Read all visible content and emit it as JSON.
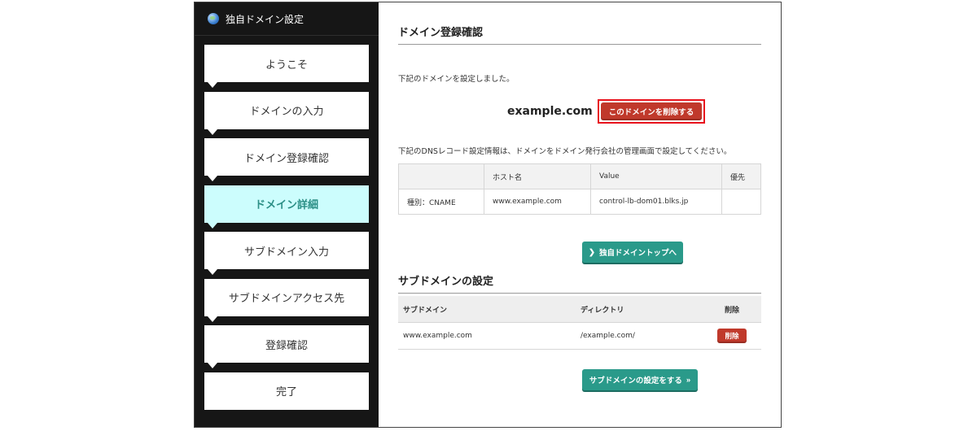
{
  "sidebar": {
    "title": "独自ドメイン設定",
    "steps": [
      {
        "label": "ようこそ"
      },
      {
        "label": "ドメインの入力"
      },
      {
        "label": "ドメイン登録確認"
      },
      {
        "label": "ドメイン詳細",
        "active": true
      },
      {
        "label": "サブドメイン入力"
      },
      {
        "label": "サブドメインアクセス先"
      },
      {
        "label": "登録確認"
      },
      {
        "label": "完了"
      }
    ]
  },
  "main": {
    "heading": "ドメイン登録確認",
    "intro": "下記のドメインを設定しました。",
    "domain": "example.com",
    "delete_domain_label": "このドメインを削除する",
    "dns_note": "下記のDNSレコード設定情報は、ドメインをドメイン発行会社の管理画面で設定してください。",
    "dns_table": {
      "headers": [
        "",
        "ホスト名",
        "Value",
        "優先"
      ],
      "rows": [
        [
          "種別：CNAME",
          "www.example.com",
          "control-lb-dom01.blks.jp",
          ""
        ]
      ]
    },
    "top_button_label": "独自ドメイントップへ",
    "sub_heading": "サブドメインの設定",
    "sub_table": {
      "headers": [
        "サブドメイン",
        "ディレクトリ",
        "削除"
      ],
      "rows": [
        [
          "www.example.com",
          "/example.com/",
          "削除"
        ]
      ]
    },
    "sub_button_label": "サブドメインの設定をする"
  },
  "colors": {
    "accent_teal": "#2a9a8a",
    "danger_red": "#c0392b",
    "active_step_bg": "#ccfdfd",
    "highlight_border": "#e8141e"
  }
}
